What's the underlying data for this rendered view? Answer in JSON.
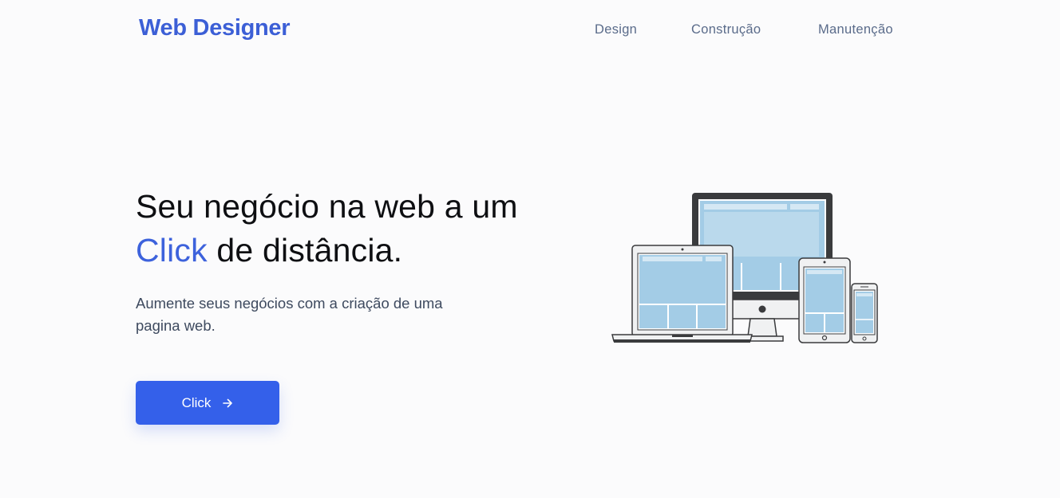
{
  "header": {
    "logo": "Web Designer",
    "nav": [
      "Design",
      "Construção",
      "Manutenção"
    ]
  },
  "hero": {
    "title_before": "Seu negócio na web a um ",
    "title_accent": "Click",
    "title_after": " de distância.",
    "subtitle": "Aumente seus negócios com a criação de uma pagina web.",
    "cta_label": "Click",
    "cta_icon": "arrow-right-icon"
  },
  "illustration": {
    "icon": "responsive-devices-icon"
  },
  "colors": {
    "brand": "#3c5fd6",
    "accent": "#3d62dc",
    "button": "#3460ea",
    "nav_text": "#5a6b8a",
    "screen_fill": "#a3cce6",
    "device_dark": "#3a3a3a"
  }
}
